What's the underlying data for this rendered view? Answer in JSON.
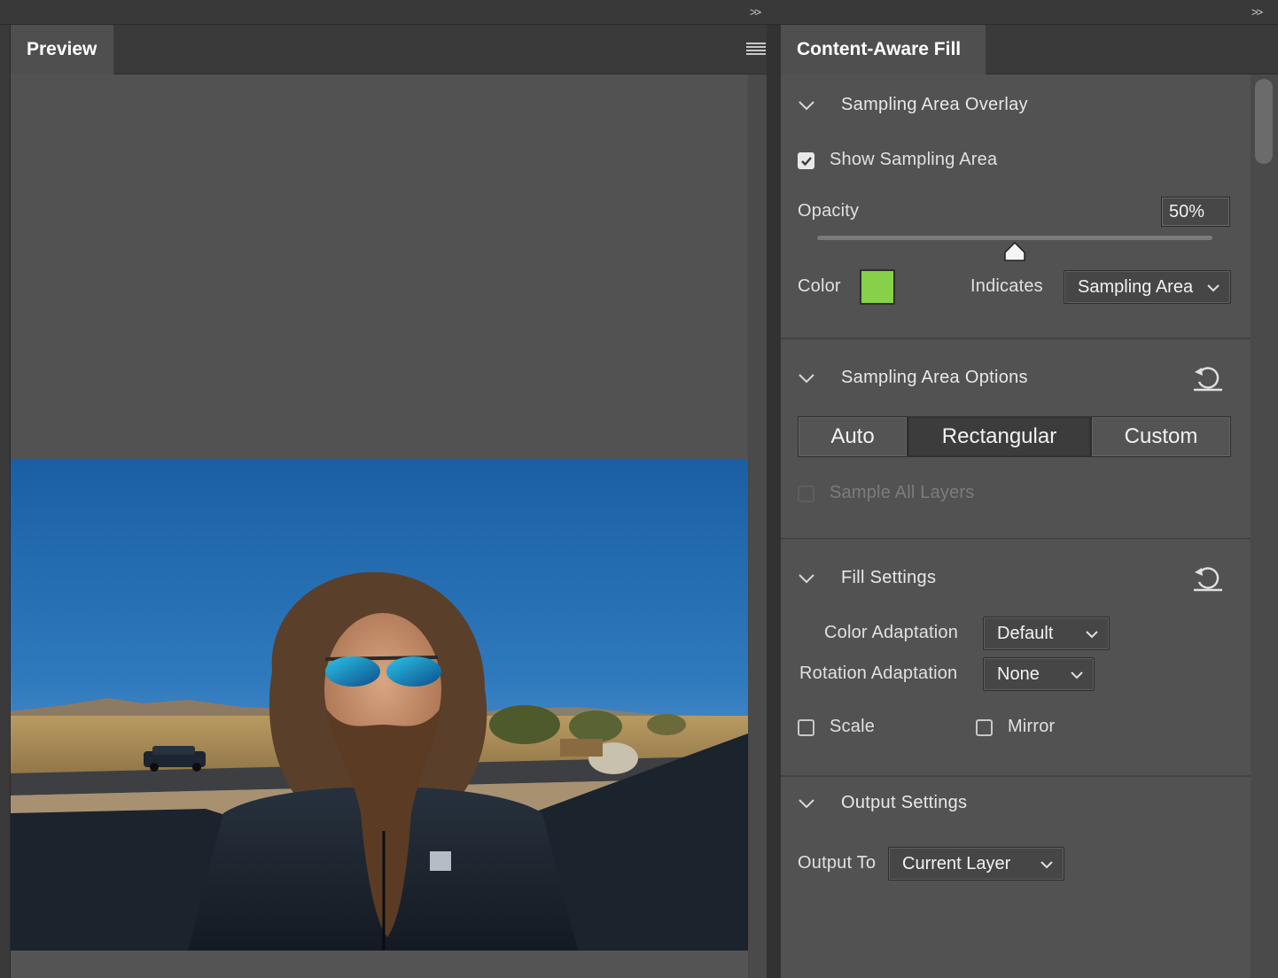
{
  "left_panel": {
    "tab_label": "Preview"
  },
  "right_panel": {
    "tab_label": "Content-Aware Fill",
    "sampling_area_overlay": {
      "title": "Sampling Area Overlay",
      "show_sampling_area_label": "Show Sampling Area",
      "show_sampling_area_checked": true,
      "opacity_label": "Opacity",
      "opacity_value": "50%",
      "opacity_fraction": 0.5,
      "color_label": "Color",
      "color_hex": "#86d04a",
      "indicates_label": "Indicates",
      "indicates_value": "Sampling Area"
    },
    "sampling_area_options": {
      "title": "Sampling Area Options",
      "modes": [
        "Auto",
        "Rectangular",
        "Custom"
      ],
      "selected_mode": "Rectangular",
      "sample_all_layers_label": "Sample All Layers",
      "sample_all_layers_enabled": false
    },
    "fill_settings": {
      "title": "Fill Settings",
      "color_adaptation_label": "Color Adaptation",
      "color_adaptation_value": "Default",
      "rotation_adaptation_label": "Rotation Adaptation",
      "rotation_adaptation_value": "None",
      "scale_label": "Scale",
      "scale_checked": false,
      "mirror_label": "Mirror",
      "mirror_checked": false
    },
    "output_settings": {
      "title": "Output Settings",
      "output_to_label": "Output To",
      "output_to_value": "Current Layer"
    }
  },
  "colors": {
    "panel_bg": "#525252",
    "tab_bar_bg": "#3a3a3a",
    "active_segment": "#3c3c3c",
    "sampling_color": "#86d04a"
  },
  "icons": {
    "collapse": "double-chevron-right-icon",
    "panel_menu": "hamburger-menu-icon",
    "section_toggle": "chevron-down-icon",
    "reset": "reset-icon",
    "dropdown": "caret-down-icon",
    "checkmark": "checkmark-icon"
  }
}
